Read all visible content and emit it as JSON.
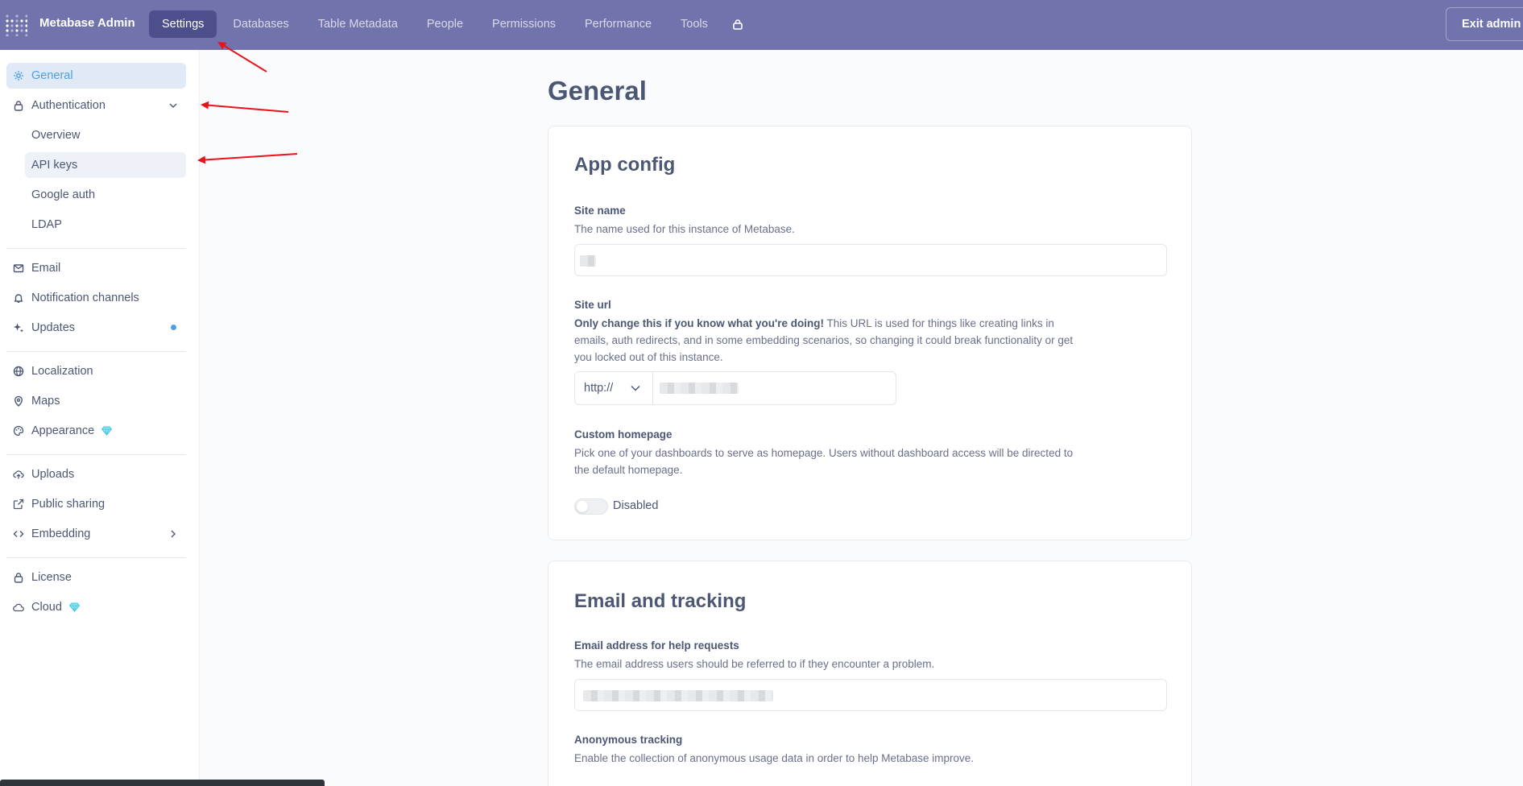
{
  "app": {
    "brand": "Metabase Admin",
    "exit_label": "Exit admin"
  },
  "nav": {
    "items": [
      {
        "label": "Settings",
        "active": true
      },
      {
        "label": "Databases"
      },
      {
        "label": "Table Metadata"
      },
      {
        "label": "People"
      },
      {
        "label": "Permissions"
      },
      {
        "label": "Performance"
      },
      {
        "label": "Tools"
      }
    ],
    "lock_icon": "lock-icon"
  },
  "sidebar": {
    "general": "General",
    "authentication": "Authentication",
    "auth_sub": [
      "Overview",
      "API keys",
      "Google auth",
      "LDAP"
    ],
    "email": "Email",
    "notification_channels": "Notification channels",
    "updates": "Updates",
    "localization": "Localization",
    "maps": "Maps",
    "appearance": "Appearance",
    "uploads": "Uploads",
    "public_sharing": "Public sharing",
    "embedding": "Embedding",
    "license": "License",
    "cloud": "Cloud"
  },
  "main": {
    "title": "General",
    "app_config": {
      "title": "App config",
      "site_name_label": "Site name",
      "site_name_desc": "The name used for this instance of Metabase.",
      "site_url_label": "Site url",
      "site_url_desc_bold": "Only change this if you know what you're doing!",
      "site_url_desc_rest": " This URL is used for things like creating links in emails, auth redirects, and in some embedding scenarios, so changing it could break functionality or get you locked out of this instance.",
      "protocol": "http://",
      "custom_homepage_label": "Custom homepage",
      "custom_homepage_desc": "Pick one of your dashboards to serve as homepage. Users without dashboard access will be directed to the default homepage.",
      "toggle_label": "Disabled"
    },
    "email_tracking": {
      "title": "Email and tracking",
      "help_email_label": "Email address for help requests",
      "help_email_desc": "The email address users should be referred to if they encounter a problem.",
      "anon_label": "Anonymous tracking",
      "anon_desc": "Enable the collection of anonymous usage data in order to help Metabase improve."
    }
  },
  "colors": {
    "topbar": "#7173ad",
    "nav_active": "#4d4f8c",
    "brand_blue": "#509ee3",
    "annotation_arrow": "#e8141c"
  }
}
